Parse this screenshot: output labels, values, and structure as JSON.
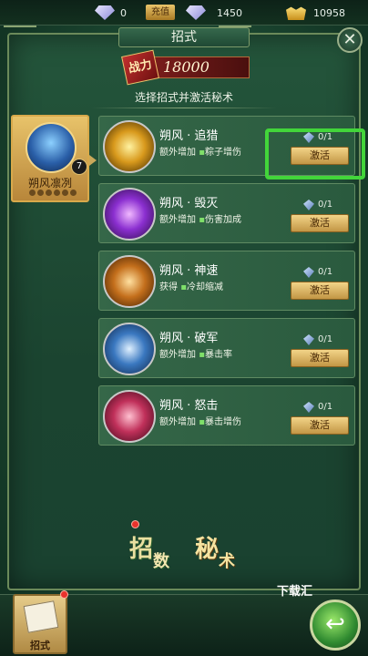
{
  "currency": {
    "diamond_a": "0",
    "recharge_label": "充值",
    "diamond_b": "1450",
    "gold": "10958"
  },
  "panel": {
    "title": "招式",
    "close_symbol": "✕",
    "power_tag": "战力",
    "power_value": "18000",
    "subtitle": "选择招式并激活秘术"
  },
  "left_card": {
    "name": "朔风凛冽",
    "badge": "7"
  },
  "skills": [
    {
      "name": "朔风 · 追猎",
      "desc_a": "额外增加",
      "desc_b": "粽子增伤",
      "count": "0/1",
      "button": "激活"
    },
    {
      "name": "朔风 · 毁灭",
      "desc_a": "额外增加",
      "desc_b": "伤害加成",
      "count": "0/1",
      "button": "激活"
    },
    {
      "name": "朔风 · 神速",
      "desc_a": "获得",
      "desc_b": "冷却缩减",
      "count": "0/1",
      "button": "激活"
    },
    {
      "name": "朔风 · 破军",
      "desc_a": "额外增加",
      "desc_b": "暴击率",
      "count": "0/1",
      "button": "激活"
    },
    {
      "name": "朔风 · 怒击",
      "desc_a": "额外增加",
      "desc_b": "暴击增伤",
      "count": "0/1",
      "button": "激活"
    }
  ],
  "bottom": {
    "skill_btn_big": "招",
    "skill_btn_small": "数",
    "secret_btn_big": "秘",
    "secret_btn_small": "术",
    "tab_label": "招式",
    "watermark": "下载汇",
    "back_symbol": "↩"
  },
  "colors": {
    "highlight": "#42d53a",
    "stat": "#7fe06a"
  }
}
